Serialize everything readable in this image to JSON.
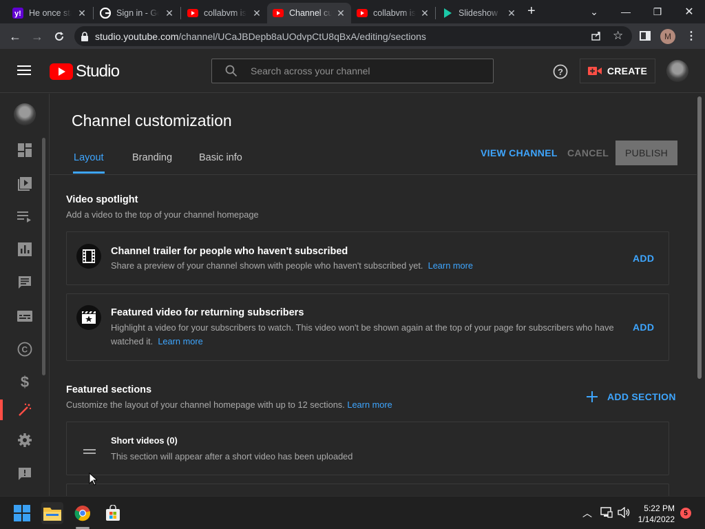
{
  "browser": {
    "tabs": [
      {
        "title": "He once stated",
        "icon": "yahoo-icon",
        "active": false
      },
      {
        "title": "Sign in - Google",
        "icon": "google-icon",
        "active": false
      },
      {
        "title": "collabvm is",
        "icon": "youtube-icon",
        "active": false
      },
      {
        "title": "Channel customization",
        "icon": "youtube-icon",
        "active": true
      },
      {
        "title": "collabvm is",
        "icon": "youtube-icon",
        "active": false
      },
      {
        "title": "Slideshow",
        "icon": "play-icon",
        "active": false
      }
    ],
    "new_tab": "+",
    "url_host": "studio.youtube.com",
    "url_path": "/channel/UCaJBDepb8aUOdvpCtU8qBxA/editing/sections",
    "profile_initial": "M"
  },
  "header": {
    "logo_text": "Studio",
    "search_placeholder": "Search across your channel",
    "create_label": "CREATE"
  },
  "page": {
    "title": "Channel customization",
    "tabs": [
      "Layout",
      "Branding",
      "Basic info"
    ],
    "view_channel": "VIEW CHANNEL",
    "cancel": "CANCEL",
    "publish": "PUBLISH"
  },
  "spotlight": {
    "heading": "Video spotlight",
    "subheading": "Add a video to the top of your channel homepage",
    "trailer": {
      "title": "Channel trailer for people who haven't subscribed",
      "desc": "Share a preview of your channel shown with people who haven't subscribed yet.",
      "learn_more": "Learn more",
      "add": "ADD"
    },
    "featured": {
      "title": "Featured video for returning subscribers",
      "desc_line1": "Highlight a video for your subscribers to watch. This video won't be shown again at the top of your page for subscribers who have",
      "desc_line2": "watched it.",
      "learn_more": "Learn more",
      "add": "ADD"
    }
  },
  "featured_sections": {
    "heading": "Featured sections",
    "subheading": "Customize the layout of your channel homepage with up to 12 sections.",
    "learn_more": "Learn more",
    "add_section": "ADD SECTION",
    "items": [
      {
        "title": "Short videos (0)",
        "desc": "This section will appear after a short video has been uploaded"
      }
    ]
  },
  "taskbar": {
    "time": "5:22 PM",
    "date": "1/14/2022",
    "notifications": "5"
  },
  "colors": {
    "accent": "#3ea6ff",
    "youtube_red": "#ff0000",
    "background": "#282828"
  }
}
